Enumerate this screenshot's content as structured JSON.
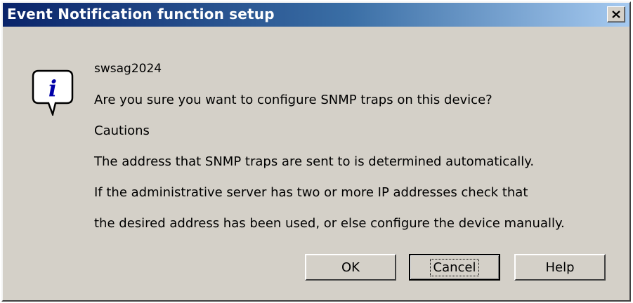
{
  "window": {
    "title": "Event Notification function setup",
    "close_label": "×"
  },
  "icon": {
    "name": "information-icon",
    "glyph": "i"
  },
  "message": {
    "device": "swsag2024",
    "question": "Are you sure you want to configure SNMP traps on this device?",
    "cautions_heading": "Cautions",
    "caution_lines": [
      "The address that SNMP traps are sent to is determined automatically.",
      "If the administrative server has two or more IP addresses check that",
      "the desired address has been used, or else configure the device manually."
    ]
  },
  "buttons": {
    "ok": "OK",
    "cancel": "Cancel",
    "help": "Help"
  },
  "focused_button": "cancel",
  "colors": {
    "face": "#d4d0c8",
    "title_start": "#0a246a",
    "title_end": "#a6caf0"
  }
}
